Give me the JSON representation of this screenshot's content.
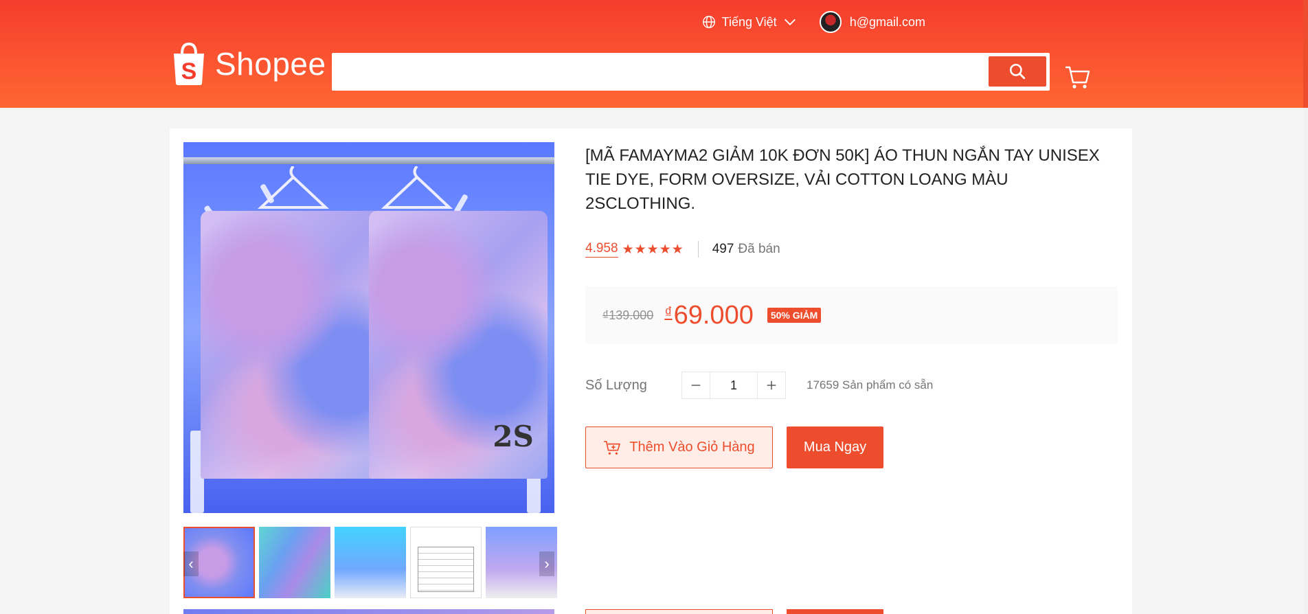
{
  "header": {
    "language": "Tiếng Việt",
    "user_email": "h@gmail.com",
    "brand": "Shopee",
    "search": {
      "value": "",
      "placeholder": ""
    }
  },
  "product": {
    "title": "[MÃ FAMAYMA2 GIẢM 10K ĐƠN 50K] ÁO THUN NGẮN TAY UNISEX TIE DYE, FORM OVERSIZE, VẢI COTTON LOANG MÀU 2SCLOTHING.",
    "rating": "4.958",
    "stars": "★★★★★",
    "sold_count": "497",
    "sold_label": "Đã bán",
    "old_price": "₫139.000",
    "currency_symbol": "₫",
    "new_price": "69.000",
    "discount_badge": "50% GIẢM",
    "quantity_label": "Số Lượng",
    "quantity": "1",
    "stock_text": "17659 Sản phẩm có sẵn",
    "add_to_cart_label": "Thêm Vào Giỏ Hàng",
    "buy_now_label": "Mua Ngay"
  },
  "gallery": {
    "thumbnail_count": 5,
    "active_index": 0,
    "prev_icon": "chevron-left-icon",
    "next_icon": "chevron-right-icon"
  },
  "colors": {
    "brand": "#ee4d2d",
    "header_gradient_top": "#f53d2d",
    "header_gradient_bottom": "#ff6633",
    "price_box_bg": "#fafafa",
    "cart_button_bg": "#ffeee8"
  },
  "icons": [
    "globe-icon",
    "chevron-down-icon",
    "avatar",
    "shopee-bag-icon",
    "search-icon",
    "cart-icon",
    "minus-icon",
    "plus-icon",
    "add-to-cart-icon"
  ]
}
